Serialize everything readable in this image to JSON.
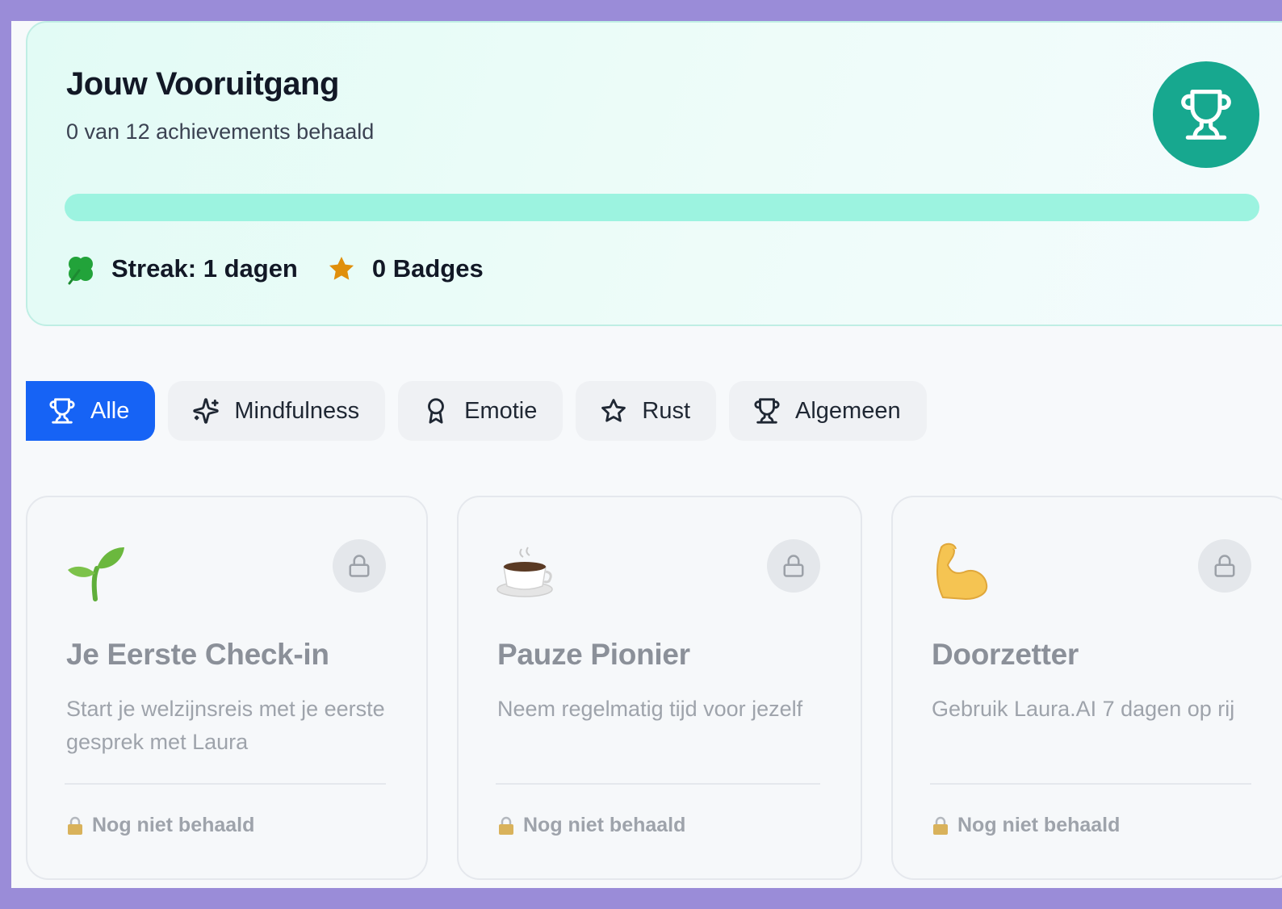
{
  "progress": {
    "title": "Jouw Vooruitgang",
    "subtitle": "0 van 12 achievements behaald",
    "achieved": 0,
    "total": 12,
    "streak_label": "Streak: 1 dagen",
    "badges_label": "0 Badges"
  },
  "tabs": [
    {
      "label": "Alle",
      "icon": "trophy-icon",
      "active": true
    },
    {
      "label": "Mindfulness",
      "icon": "sparkles-icon",
      "active": false
    },
    {
      "label": "Emotie",
      "icon": "award-icon",
      "active": false
    },
    {
      "label": "Rust",
      "icon": "star-icon",
      "active": false
    },
    {
      "label": "Algemeen",
      "icon": "trophy-icon",
      "active": false
    }
  ],
  "achievements": [
    {
      "icon": "seedling-icon",
      "title": "Je Eerste Check-in",
      "description": "Start je welzijnsreis met je eerste gesprek met Laura",
      "status": "Nog niet behaald"
    },
    {
      "icon": "coffee-cup-icon",
      "title": "Pauze Pionier",
      "description": "Neem regelmatig tijd voor jezelf",
      "status": "Nog niet behaald"
    },
    {
      "icon": "flexed-biceps-icon",
      "title": "Doorzetter",
      "description": "Gebruik Laura.AI 7 dagen op rij",
      "status": "Nog niet behaald"
    }
  ],
  "colors": {
    "accent": "#17a88f",
    "progress_track": "#9cf3e0",
    "active_tab": "#1663f5",
    "background_frame": "#9a8cd8"
  }
}
